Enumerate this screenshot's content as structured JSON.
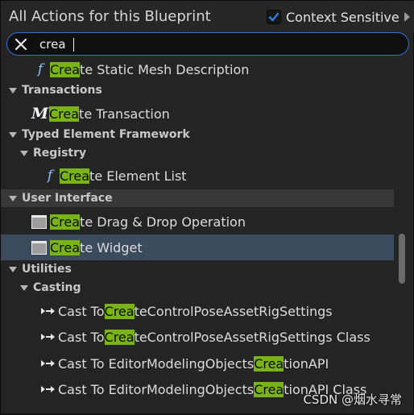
{
  "header": {
    "title": "All Actions for this Blueprint",
    "context_label": "Context Sensitive",
    "context_checked": true
  },
  "search": {
    "value": "crea"
  },
  "items": [
    {
      "type": "item",
      "icon": "function-icon",
      "pre": "",
      "match": "Crea",
      "post": "te Static Mesh Description"
    },
    {
      "type": "category",
      "label": "Transactions"
    },
    {
      "type": "item",
      "icon": "macro-icon",
      "pre": "",
      "match": "Crea",
      "post": "te Transaction"
    },
    {
      "type": "category",
      "label": "Typed Element Framework"
    },
    {
      "type": "category",
      "label": "Registry"
    },
    {
      "type": "item",
      "icon": "function-icon",
      "pre": "",
      "match": "Crea",
      "post": "te Element List"
    },
    {
      "type": "category",
      "label": "User Interface"
    },
    {
      "type": "item",
      "icon": "widget-icon",
      "pre": "",
      "match": "Crea",
      "post": "te Drag & Drop Operation"
    },
    {
      "type": "item",
      "icon": "widget-icon",
      "pre": "",
      "match": "Crea",
      "post": "te Widget"
    },
    {
      "type": "category",
      "label": "Utilities"
    },
    {
      "type": "category",
      "label": "Casting"
    },
    {
      "type": "item",
      "icon": "cast-icon",
      "pre": "Cast To ",
      "match": "Crea",
      "post": "teControlPoseAssetRigSettings"
    },
    {
      "type": "item",
      "icon": "cast-icon",
      "pre": "Cast To ",
      "match": "Crea",
      "post": "teControlPoseAssetRigSettings Class"
    },
    {
      "type": "item",
      "icon": "cast-icon",
      "pre": "Cast To EditorModelingObjects",
      "match": "Crea",
      "post": "tionAPI"
    },
    {
      "type": "item",
      "icon": "cast-icon",
      "pre": "Cast To EditorModelingObjects",
      "match": "Crea",
      "post": "tionAPI Class"
    }
  ],
  "watermark": "CSDN @烟水寻常"
}
